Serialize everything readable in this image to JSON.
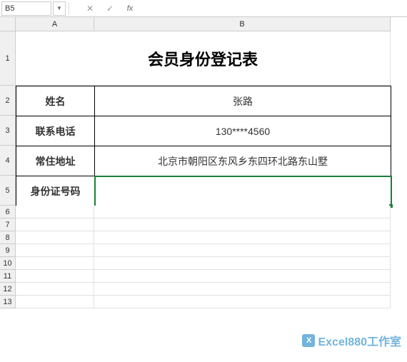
{
  "formula_bar": {
    "cell_ref": "B5",
    "cancel": "✕",
    "enter": "✓",
    "fx": "fx",
    "formula": ""
  },
  "columns": {
    "A": "A",
    "B": "B"
  },
  "rows": [
    "1",
    "2",
    "3",
    "4",
    "5",
    "6",
    "7",
    "8",
    "9",
    "10",
    "11",
    "12",
    "13"
  ],
  "form": {
    "title": "会员身份登记表",
    "name_label": "姓名",
    "name_value": "张路",
    "phone_label": "联系电话",
    "phone_value": "130****4560",
    "address_label": "常住地址",
    "address_value": "北京市朝阳区东风乡东四环北路东山墅",
    "idnum_label": "身份证号码",
    "idnum_value": ""
  },
  "watermark": "Excel880工作室",
  "watermark_icon": "X"
}
